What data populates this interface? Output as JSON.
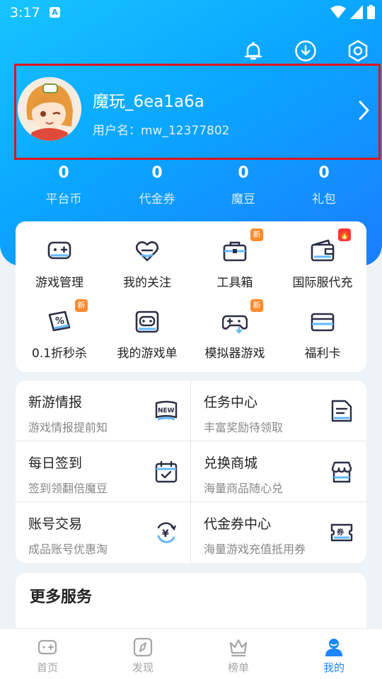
{
  "status_bar": {
    "time": "3:17"
  },
  "profile": {
    "username": "魔玩_6ea1a6a",
    "user_id_label": "用户名：mw_12377802"
  },
  "stats": [
    {
      "value": "0",
      "label": "平台币"
    },
    {
      "value": "0",
      "label": "代金券"
    },
    {
      "value": "0",
      "label": "魔豆"
    },
    {
      "value": "0",
      "label": "礼包"
    }
  ],
  "grid": {
    "items": [
      {
        "label": "游戏管理",
        "icon": "gamepad-icon",
        "badge": ""
      },
      {
        "label": "我的关注",
        "icon": "heart-icon",
        "badge": ""
      },
      {
        "label": "工具箱",
        "icon": "toolbox-icon",
        "badge": "新"
      },
      {
        "label": "国际服代充",
        "icon": "wallet-icon",
        "badge": "🔥"
      },
      {
        "label": "0.1折秒杀",
        "icon": "discount-icon",
        "badge": "新"
      },
      {
        "label": "我的游戏单",
        "icon": "game-list-icon",
        "badge": ""
      },
      {
        "label": "模拟器游戏",
        "icon": "emulator-icon",
        "badge": "新"
      },
      {
        "label": "福利卡",
        "icon": "card-icon",
        "badge": ""
      }
    ]
  },
  "tiles": [
    {
      "title": "新游情报",
      "subtitle": "游戏情报提前知",
      "icon": "new-badge-icon"
    },
    {
      "title": "任务中心",
      "subtitle": "丰富奖励待领取",
      "icon": "task-doc-icon"
    },
    {
      "title": "每日签到",
      "subtitle": "签到领翻倍魔豆",
      "icon": "calendar-check-icon"
    },
    {
      "title": "兑换商城",
      "subtitle": "海量商品随心兑",
      "icon": "store-icon"
    },
    {
      "title": "账号交易",
      "subtitle": "成品账号优惠淘",
      "icon": "yen-exchange-icon"
    },
    {
      "title": "代金券中心",
      "subtitle": "海量游戏充值抵用券",
      "icon": "coupon-icon"
    }
  ],
  "more": {
    "title": "更多服务"
  },
  "bottom_nav": [
    {
      "label": "首页",
      "icon": "home-gamepad-icon"
    },
    {
      "label": "发现",
      "icon": "compass-icon"
    },
    {
      "label": "榜单",
      "icon": "crown-icon"
    },
    {
      "label": "我的",
      "icon": "user-icon"
    }
  ],
  "colors": {
    "accent": "#1a86ff",
    "badge_new": "#ff8a30",
    "badge_hot": "#ff3636",
    "highlight_border": "#e0141e"
  }
}
